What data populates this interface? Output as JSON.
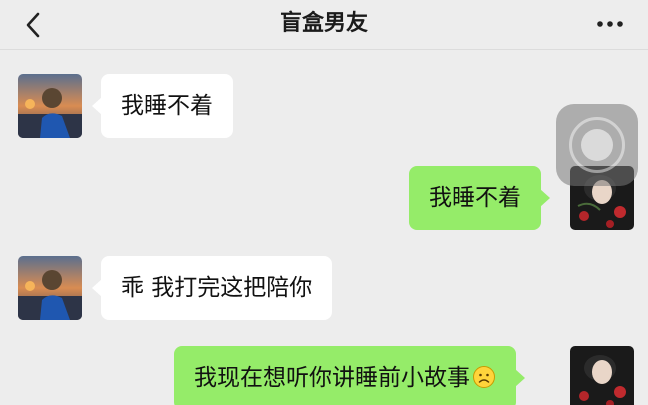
{
  "header": {
    "title": "盲盒男友",
    "back_icon": "chevron-left-icon",
    "more_icon": "more-dots-icon"
  },
  "messages": [
    {
      "side": "left",
      "text": "我睡不着"
    },
    {
      "side": "right",
      "text": "我睡不着"
    },
    {
      "side": "left",
      "text": "乖 我打完这把陪你"
    },
    {
      "side": "right",
      "text": "我现在想听你讲睡前小故事",
      "emoji": "frowning-face-icon"
    }
  ],
  "colors": {
    "background": "#ededed",
    "incoming_bubble": "#ffffff",
    "outgoing_bubble": "#95ec69"
  },
  "overlay": {
    "icon": "assistive-touch-icon"
  }
}
